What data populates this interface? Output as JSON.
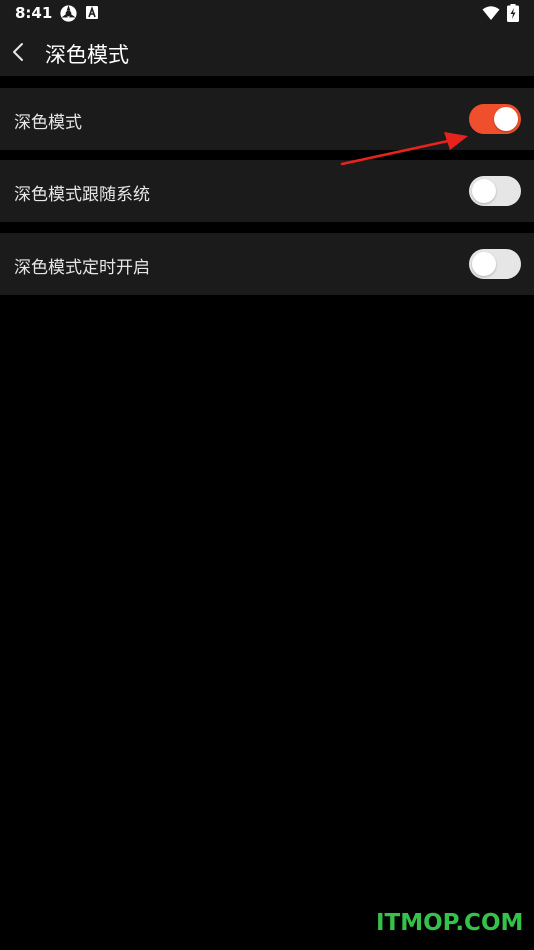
{
  "status_bar": {
    "time": "8:41"
  },
  "app_bar": {
    "title": "深色模式",
    "back_icon": "chevron-left-icon"
  },
  "settings": {
    "items": [
      {
        "label": "深色模式",
        "enabled": true
      },
      {
        "label": "深色模式跟随系统",
        "enabled": false
      },
      {
        "label": "深色模式定时开启",
        "enabled": false
      }
    ]
  },
  "colors": {
    "background": "#000000",
    "surface": "#1b1b1b",
    "accent": "#ef4f2c",
    "switch_off": "#e6e6e6",
    "annotation": "#e8231d",
    "watermark": "#35c24a"
  },
  "watermark": "ITMOP.COM"
}
